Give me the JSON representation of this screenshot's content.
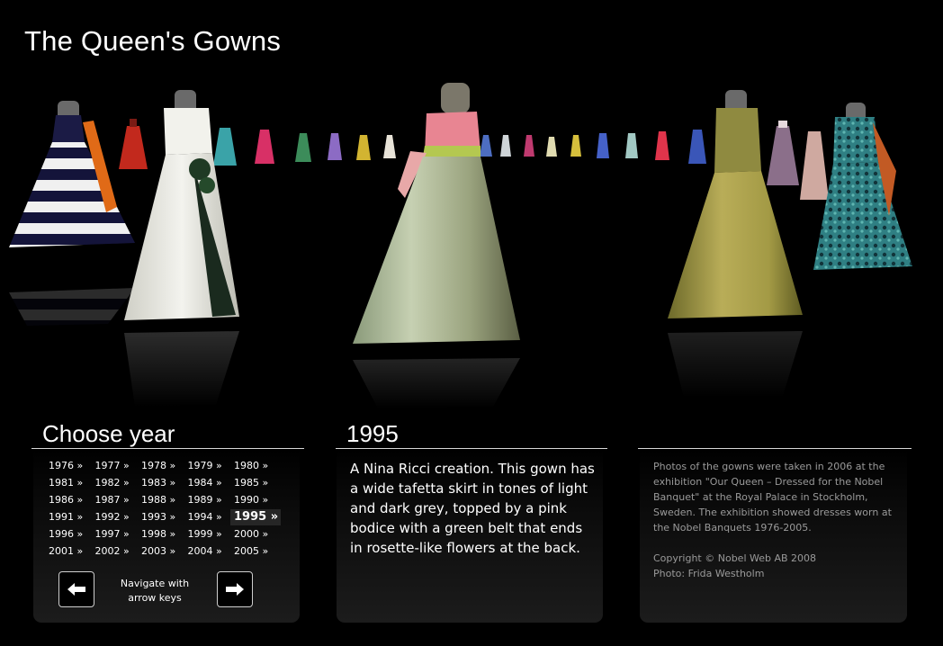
{
  "page_title": "The Queen's Gowns",
  "choose_year": {
    "heading": "Choose year",
    "years": [
      "1976 »",
      "1977 »",
      "1978 »",
      "1979 »",
      "1980 »",
      "1981 »",
      "1982 »",
      "1983 »",
      "1984 »",
      "1985 »",
      "1986 »",
      "1987 »",
      "1988 »",
      "1989 »",
      "1990 »",
      "1991 »",
      "1992 »",
      "1993 »",
      "1994 »",
      "1995 »",
      "1996 »",
      "1997 »",
      "1998 »",
      "1999 »",
      "2000 »",
      "2001 »",
      "2002 »",
      "2003 »",
      "2004 »",
      "2005 »"
    ],
    "selected": "1995 »",
    "nav_hint_line1": "Navigate with",
    "nav_hint_line2": "arrow keys",
    "prev_icon": "left-arrow-icon",
    "next_icon": "right-arrow-icon"
  },
  "detail": {
    "year": "1995",
    "description": "A Nina Ricci creation. This gown has a wide tafetta skirt in tones of light and dark grey, topped by a pink bodice with a green belt that ends in rosette-like flowers at the back."
  },
  "info": {
    "photos_text": "Photos of the gowns were taken in 2006 at the exhibition \"Our Queen – Dressed for the Nobel Banquet\" at the Royal Palace in Stockholm, Sweden. The exhibition showed dresses worn at the Nobel Banquets 1976-2005.",
    "copyright": "Copyright © Nobel Web AB 2008",
    "photo_credit": "Photo: Frida Westholm"
  }
}
